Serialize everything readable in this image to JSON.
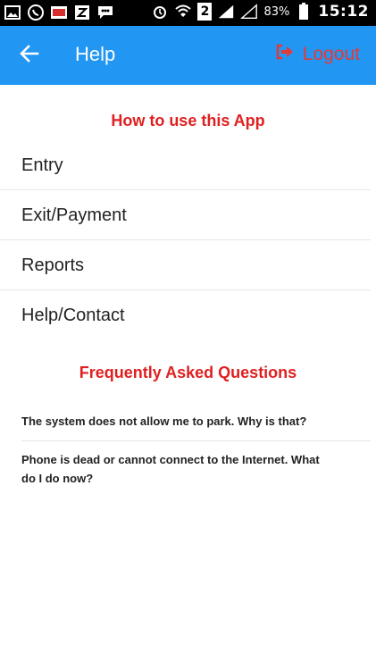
{
  "status_bar": {
    "battery": "83%",
    "time": "15:12",
    "sim": "2"
  },
  "app_bar": {
    "title": "Help",
    "logout_label": "Logout"
  },
  "how_to": {
    "title": "How to use this App",
    "items": [
      {
        "label": "Entry"
      },
      {
        "label": "Exit/Payment"
      },
      {
        "label": "Reports"
      },
      {
        "label": "Help/Contact"
      }
    ]
  },
  "faq": {
    "title": "Frequently Asked Questions",
    "questions": [
      {
        "text": "The system does not allow me to park. Why is that?"
      },
      {
        "text": "Phone is dead or cannot connect to the Internet. What do I do now?"
      }
    ]
  },
  "colors": {
    "app_bar": "#2196F3",
    "accent_red": "#e02020"
  }
}
